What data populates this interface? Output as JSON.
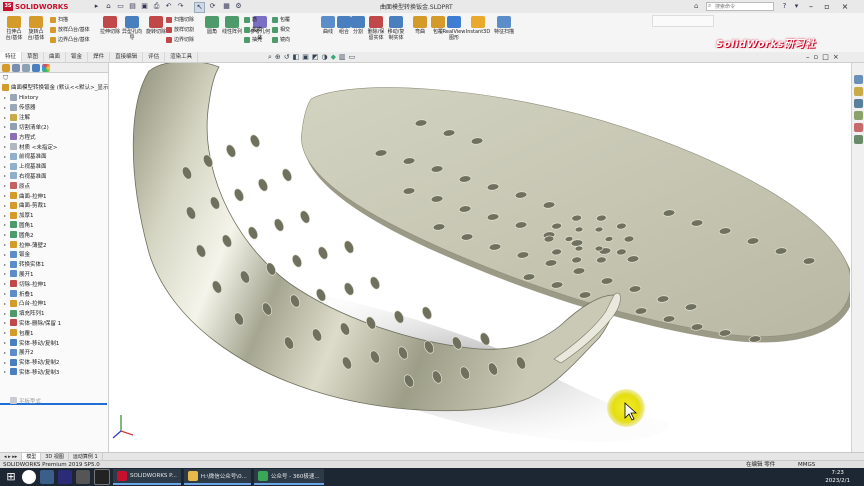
{
  "app": {
    "logo": "SOLIDWORKS",
    "logo_mark": "3S",
    "document_title": "曲面模型转换钣金.SLDPRT",
    "search_placeholder": "搜索命令",
    "brand_watermark": "SolidWorks研习社"
  },
  "ribbon": {
    "buttons": [
      {
        "label": "拉伸凸台/基体",
        "color": "#d49a2a"
      },
      {
        "label": "旋转凸台/基体",
        "color": "#d49a2a"
      },
      {
        "label": "拉伸切除",
        "color": "#c04848"
      },
      {
        "label": "异型孔向导",
        "color": "#4a7fbf"
      },
      {
        "label": "旋转切除",
        "color": "#c04848"
      },
      {
        "label": "圆角",
        "color": "#4d9b6b"
      },
      {
        "label": "线性阵列",
        "color": "#4d9b6b"
      },
      {
        "label": "参考几何体",
        "color": "#7a6fc4"
      },
      {
        "label": "曲线",
        "color": "#5a8dc9"
      },
      {
        "label": "组合",
        "color": "#4a7fbf"
      },
      {
        "label": "分割",
        "color": "#4a7fbf"
      },
      {
        "label": "删除/保留实体",
        "color": "#c04848"
      },
      {
        "label": "移动/复制实体",
        "color": "#4a7fbf"
      },
      {
        "label": "弯曲",
        "color": "#d49a2a"
      },
      {
        "label": "包覆",
        "color": "#d49a2a"
      },
      {
        "label": "RealView图形",
        "color": "#3d7ed4"
      },
      {
        "label": "Instant3D",
        "color": "#e8a92c"
      },
      {
        "label": "特征扫描",
        "color": "#5a8dc9"
      }
    ],
    "small_rows": [
      {
        "label": "扫描",
        "color": "#d49a2a"
      },
      {
        "label": "放样凸台/基体",
        "color": "#d49a2a"
      },
      {
        "label": "边界凸台/基体",
        "color": "#d49a2a"
      },
      {
        "label": "扫描切除",
        "color": "#c04848"
      },
      {
        "label": "放样切割",
        "color": "#c04848"
      },
      {
        "label": "边界切除",
        "color": "#c04848"
      },
      {
        "label": "筋",
        "color": "#4d9b6b"
      },
      {
        "label": "拔模",
        "color": "#4d9b6b"
      },
      {
        "label": "抽壳",
        "color": "#4d9b6b"
      },
      {
        "label": "包覆",
        "color": "#4d9b6b"
      },
      {
        "label": "相交",
        "color": "#4d9b6b"
      },
      {
        "label": "镜向",
        "color": "#4d9b6b"
      }
    ]
  },
  "command_tabs": [
    "特征",
    "草图",
    "曲面",
    "钣金",
    "焊件",
    "直接编辑",
    "评估",
    "渲染工具"
  ],
  "feature_tree": {
    "root": "曲面模型转换钣金 (默认<<默认>_显示",
    "items": [
      {
        "label": "History",
        "color": "#9aa7b8"
      },
      {
        "label": "传感器",
        "color": "#9aa7b8"
      },
      {
        "label": "注解",
        "color": "#c9a94a"
      },
      {
        "label": "切割清单(2)",
        "color": "#8fa0b3"
      },
      {
        "label": "方程式",
        "color": "#8a6fb8"
      },
      {
        "label": "材质 <未指定>",
        "color": "#b0b7c0"
      },
      {
        "label": "前视基准面",
        "color": "#8fb0cc"
      },
      {
        "label": "上视基准面",
        "color": "#8fb0cc"
      },
      {
        "label": "右视基准面",
        "color": "#8fb0cc"
      },
      {
        "label": "原点",
        "color": "#c46060"
      },
      {
        "label": "曲面-拉伸1",
        "color": "#d49a2a"
      },
      {
        "label": "曲面-剪裁1",
        "color": "#d49a2a"
      },
      {
        "label": "加厚1",
        "color": "#d49a2a"
      },
      {
        "label": "圆角1",
        "color": "#4d9b6b"
      },
      {
        "label": "圆角2",
        "color": "#4d9b6b"
      },
      {
        "label": "拉伸-薄壁2",
        "color": "#d49a2a"
      },
      {
        "label": "钣金",
        "color": "#5a8dc9"
      },
      {
        "label": "转换实体1",
        "color": "#5a8dc9"
      },
      {
        "label": "展开1",
        "color": "#5a8dc9"
      },
      {
        "label": "切除-拉伸1",
        "color": "#c04848"
      },
      {
        "label": "折叠1",
        "color": "#5a8dc9"
      },
      {
        "label": "凸台-拉伸1",
        "color": "#d49a2a"
      },
      {
        "label": "填充阵列1",
        "color": "#4d9b6b"
      },
      {
        "label": "实体-删除/保留 1",
        "color": "#c04848"
      },
      {
        "label": "包覆1",
        "color": "#d49a2a"
      },
      {
        "label": "实体-移动/复制1",
        "color": "#4a7fbf"
      },
      {
        "label": "展开2",
        "color": "#5a8dc9"
      },
      {
        "label": "实体-移动/复制2",
        "color": "#4a7fbf"
      },
      {
        "label": "实体-移动/复制3",
        "color": "#4a7fbf"
      }
    ],
    "rolled_back": "平板型式"
  },
  "bottom_tabs": [
    "模型",
    "3D 视图",
    "运动算例 1"
  ],
  "status": {
    "left": "SOLIDWORKS Premium 2019 SP5.0",
    "mode": "在编辑 零件",
    "units": "MMGS"
  },
  "taskbar": {
    "tasks": [
      {
        "label": "SOLIDWORKS P...",
        "color": "#c8102e"
      },
      {
        "label": "H:\\微信公众号\\0...",
        "color": "#e8b84a"
      },
      {
        "label": "公众号 - 360极速...",
        "color": "#3aa757"
      }
    ],
    "time": "7:23",
    "date": "2023/2/1"
  }
}
